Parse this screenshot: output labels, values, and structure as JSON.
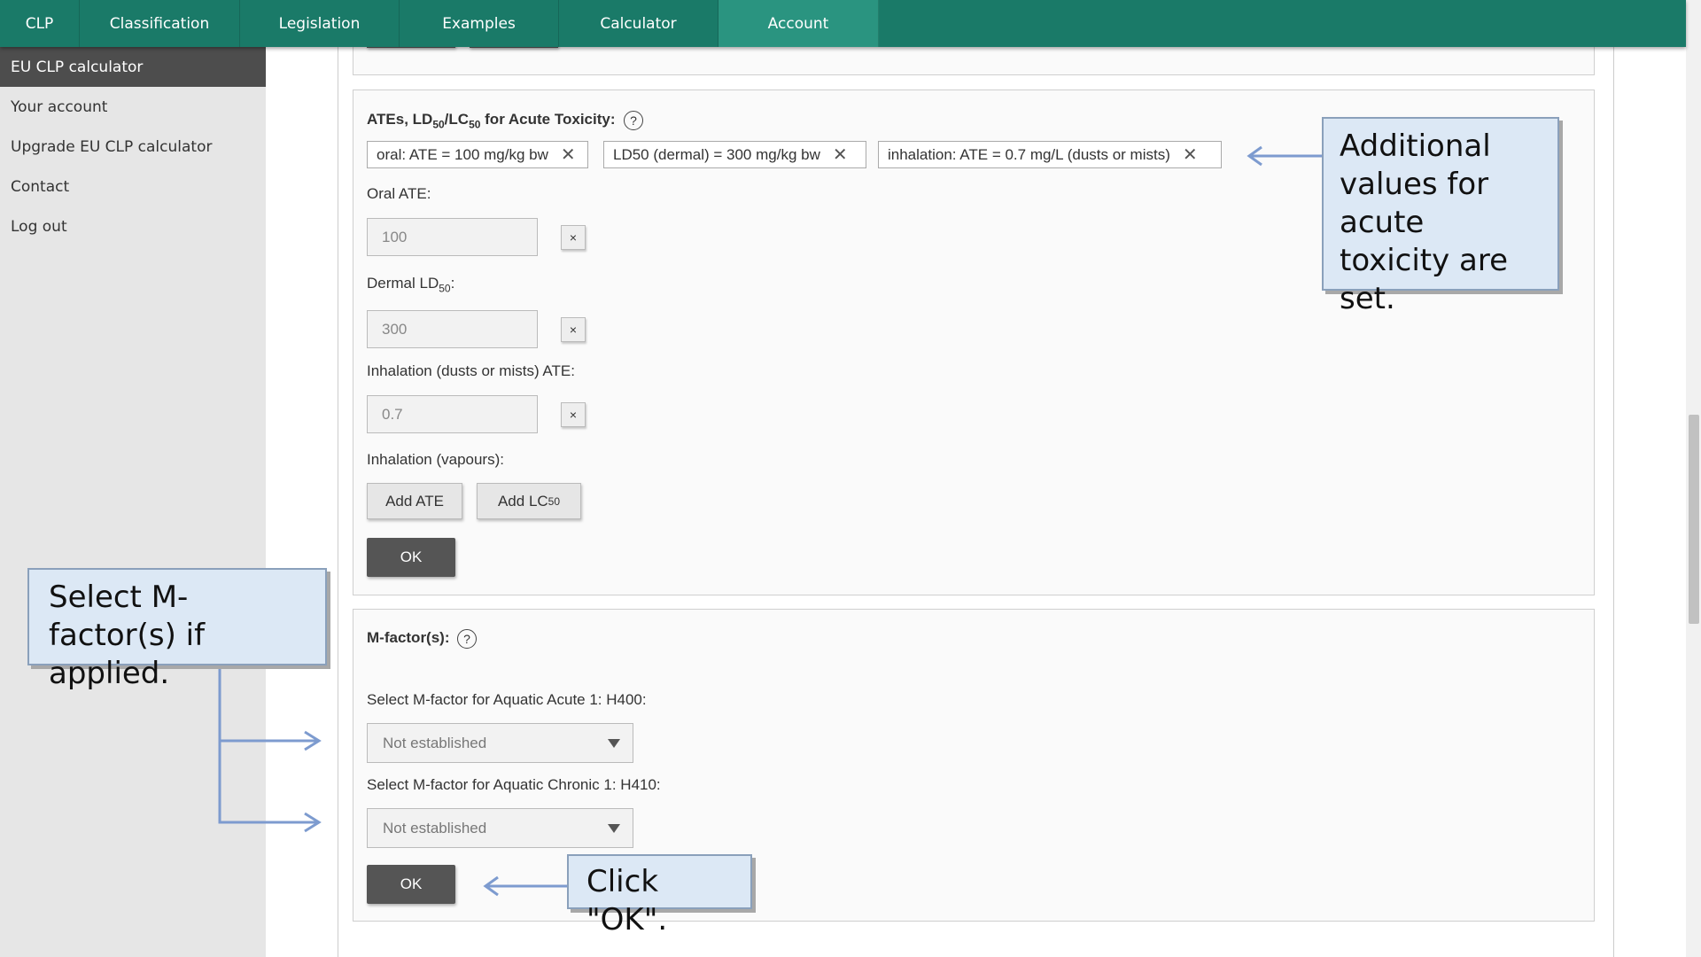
{
  "nav": {
    "tabs": [
      "CLP",
      "Classification",
      "Legislation",
      "Examples",
      "Calculator",
      "Account"
    ]
  },
  "sidebar": {
    "items": [
      {
        "label": "EU CLP calculator"
      },
      {
        "label": "Your account"
      },
      {
        "label": "Upgrade EU CLP calculator"
      },
      {
        "label": "Contact"
      },
      {
        "label": "Log out"
      }
    ]
  },
  "acute": {
    "title_pre": "ATEs, LD",
    "title_sub1": "50",
    "title_mid": "/LC",
    "title_sub2": "50",
    "title_post": " for Acute Toxicity:",
    "help": "?",
    "tags": [
      {
        "label": "oral: ATE = 100 mg/kg bw",
        "remove": "✕"
      },
      {
        "label": "LD50 (dermal) = 300 mg/kg bw",
        "remove": "✕"
      },
      {
        "label": "inhalation: ATE = 0.7 mg/L (dusts or mists)",
        "remove": "✕"
      }
    ],
    "oral_label": "Oral ATE:",
    "oral_value": "100",
    "dermal_label_pre": "Dermal LD",
    "dermal_label_sub": "50",
    "dermal_label_post": ":",
    "dermal_value": "300",
    "inh_dust_label": "Inhalation (dusts or mists) ATE:",
    "inh_dust_value": "0.7",
    "clear": "×",
    "inh_vap_label": "Inhalation (vapours):",
    "add_ate": "Add ATE",
    "add_lc_pre": "Add LC",
    "add_lc_sub": "50",
    "ok": "OK"
  },
  "mfactor": {
    "title": "M-factor(s):",
    "help": "?",
    "acute_label": "Select M-factor for Aquatic Acute 1: H400:",
    "acute_value": "Not established",
    "chronic_label": "Select M-factor for Aquatic Chronic 1: H410:",
    "chronic_value": "Not established",
    "ok": "OK"
  },
  "callouts": {
    "acute_note": "Additional values for acute toxicity are set.",
    "mfactor_note": "Select M-factor(s) if applied.",
    "ok_note": "Click \"OK\"."
  },
  "colors": {
    "nav": "#1a7a68",
    "nav_active": "#2a9480",
    "callout_bg": "#dce8f5",
    "arrow": "#7d9bcf"
  }
}
